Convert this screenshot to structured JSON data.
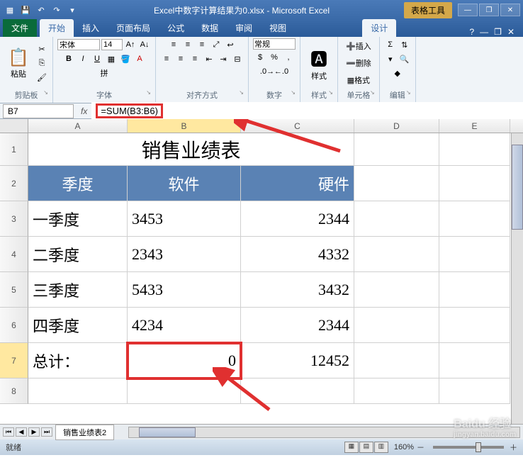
{
  "window": {
    "title": "Excel中数字计算结果为0.xlsx - Microsoft Excel",
    "context_tab_group": "表格工具",
    "min": "—",
    "max": "❐",
    "close": "✕"
  },
  "tabs": {
    "file": "文件",
    "home": "开始",
    "insert": "插入",
    "layout": "页面布局",
    "formulas": "公式",
    "data": "数据",
    "review": "审阅",
    "view": "视图",
    "design": "设计"
  },
  "ribbon": {
    "clipboard": {
      "label": "剪贴板",
      "paste": "粘贴"
    },
    "font": {
      "label": "字体",
      "name": "宋体",
      "size": "14",
      "bold": "B",
      "italic": "I",
      "underline": "U"
    },
    "align": {
      "label": "对齐方式"
    },
    "number": {
      "label": "数字",
      "format": "常规"
    },
    "styles": {
      "label": "样式",
      "btn": "样式"
    },
    "cells": {
      "label": "单元格",
      "insert": "插入",
      "delete": "删除",
      "format": "格式"
    },
    "editing": {
      "label": "编辑",
      "sum": "Σ",
      "fill": "▾",
      "clear": "◆"
    }
  },
  "formulabar": {
    "namebox": "B7",
    "fx": "fx",
    "formula": "=SUM(B3:B6)"
  },
  "columns": [
    "A",
    "B",
    "C",
    "D",
    "E"
  ],
  "rows": [
    "1",
    "2",
    "3",
    "4",
    "5",
    "6",
    "7",
    "8"
  ],
  "sheet": {
    "title": "销售业绩表",
    "headers": {
      "quarter": "季度",
      "software": "软件",
      "hardware": "硬件"
    },
    "data": [
      {
        "q": "一季度",
        "sw": "3453",
        "hw": "2344"
      },
      {
        "q": "二季度",
        "sw": "2343",
        "hw": "4332"
      },
      {
        "q": "三季度",
        "sw": "5433",
        "hw": "3432"
      },
      {
        "q": "四季度",
        "sw": "4234",
        "hw": "2344"
      }
    ],
    "total": {
      "label": "总计：",
      "sw": "0",
      "hw": "12452"
    }
  },
  "sheettabs": {
    "active": "销售业绩表2"
  },
  "statusbar": {
    "ready": "就绪",
    "zoom": "160%"
  },
  "watermark": {
    "main": "Baidu 经验",
    "sub": "jingyan.baidu.com"
  }
}
